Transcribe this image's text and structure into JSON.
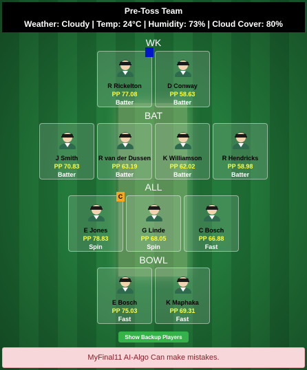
{
  "header": {
    "title": "Pre-Toss Team",
    "weather": "Weather: Cloudy | Temp: 24°C | Humidity: 73% | Cloud Cover: 80%"
  },
  "sections": {
    "wk": "WK",
    "bat": "BAT",
    "all": "ALL",
    "bowl": "BOWL"
  },
  "players": [
    {
      "name": "R Rickelton",
      "points": "PP 77.08",
      "role": "Batter",
      "badge": "VC"
    },
    {
      "name": "D Conway",
      "points": "PP 58.63",
      "role": "Batter",
      "badge": ""
    },
    {
      "name": "J  Smith",
      "points": "PP 70.83",
      "role": "Batter",
      "badge": ""
    },
    {
      "name": "R van der Dussen",
      "points": "PP 63.19",
      "role": "Batter",
      "badge": ""
    },
    {
      "name": "K Williamson",
      "points": "PP 62.02",
      "role": "Batter",
      "badge": ""
    },
    {
      "name": "R Hendricks",
      "points": "PP 58.98",
      "role": "Batter",
      "badge": ""
    },
    {
      "name": "E Jones",
      "points": "PP 78.83",
      "role": "Spin",
      "badge": "C"
    },
    {
      "name": "G Linde",
      "points": "PP 68.05",
      "role": "Spin",
      "badge": ""
    },
    {
      "name": "C Bosch",
      "points": "PP 66.88",
      "role": "Fast",
      "badge": ""
    },
    {
      "name": "E Bosch",
      "points": "PP 75.03",
      "role": "Fast",
      "badge": ""
    },
    {
      "name": "K Maphaka",
      "points": "PP 69.31",
      "role": "Fast",
      "badge": ""
    }
  ],
  "backup_button": "Show Backup Players",
  "disclaimer": "MyFinal11 AI-Algo Can make mistakes.",
  "colors": {
    "points": "#ffff33",
    "captain_badge": "#f5a623",
    "vice_captain_badge": "#0018c8",
    "backup_button": "#35b24a",
    "disclaimer_bg": "#f8d7da"
  }
}
